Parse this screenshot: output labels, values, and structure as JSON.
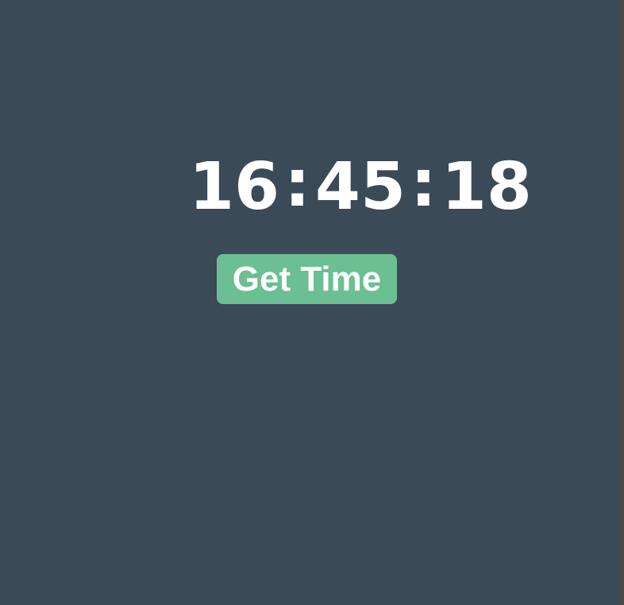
{
  "clock": {
    "hours": "16",
    "minutes": "45",
    "seconds": "18",
    "separator": ":"
  },
  "button": {
    "label": "Get Time"
  },
  "colors": {
    "background": "#3a4a56",
    "button": "#6bbf93",
    "text": "#ffffff"
  }
}
